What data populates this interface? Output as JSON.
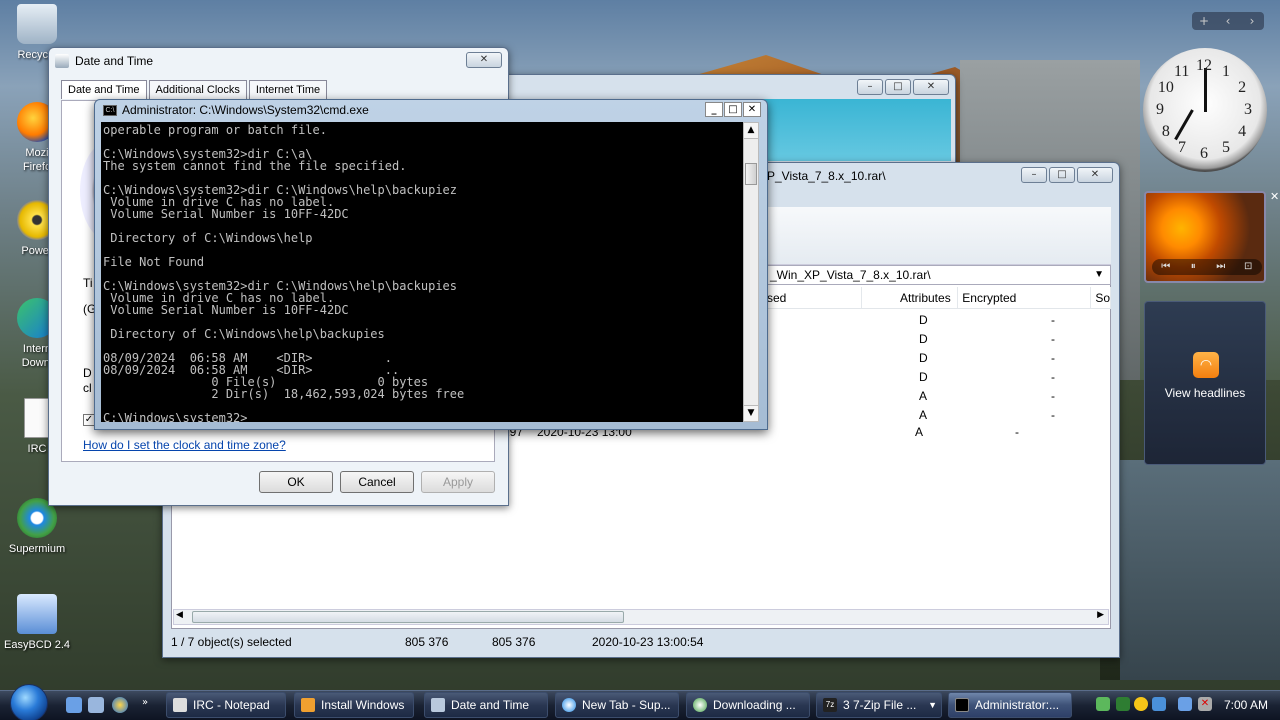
{
  "desktop": {
    "icons": [
      {
        "label": "Recycle"
      },
      {
        "label": "Mozi\nFirefo"
      },
      {
        "label": "Power"
      },
      {
        "label": "Intern\nDownl"
      },
      {
        "label": "IRC"
      },
      {
        "label": "Supermium"
      },
      {
        "label": "EasyBCD 2.4"
      }
    ]
  },
  "datetime_dialog": {
    "title": "Date and Time",
    "tabs": [
      "Date and Time",
      "Additional Clocks",
      "Internet Time"
    ],
    "side_letters": [
      "Ti",
      "(G",
      "D",
      "cl"
    ],
    "link": "How do I set the clock and time zone?",
    "buttons": {
      "ok": "OK",
      "cancel": "Cancel",
      "apply": "Apply"
    }
  },
  "zip_window": {
    "title_fragment": "P_Vista_7_8.x_10.rar\\",
    "path": "_Win_XP_Vista_7_8.x_10.rar\\",
    "columns": [
      "sed",
      "Attributes",
      "Encrypted",
      "So"
    ],
    "rows": [
      {
        "attr": "D",
        "enc": "-"
      },
      {
        "attr": "D",
        "enc": "-"
      },
      {
        "attr": "D",
        "enc": "-"
      },
      {
        "attr": "D",
        "enc": "-"
      },
      {
        "attr": "A",
        "enc": "-"
      },
      {
        "attr": "A",
        "enc": "-"
      },
      {
        "prefix": "197",
        "date": "2020-10-23 13:00",
        "attr": "A",
        "enc": "-"
      }
    ],
    "status": {
      "selected": "1 / 7 object(s) selected",
      "size": "805 376",
      "packed": "805 376",
      "modified": "2020-10-23 13:00:54"
    }
  },
  "cmd": {
    "title": "Administrator: C:\\Windows\\System32\\cmd.exe",
    "lines": [
      "operable program or batch file.",
      "",
      "C:\\Windows\\system32>dir C:\\a\\",
      "The system cannot find the file specified.",
      "",
      "C:\\Windows\\system32>dir C:\\Windows\\help\\backupiez",
      " Volume in drive C has no label.",
      " Volume Serial Number is 10FF-42DC",
      "",
      " Directory of C:\\Windows\\help",
      "",
      "File Not Found",
      "",
      "C:\\Windows\\system32>dir C:\\Windows\\help\\backupies",
      " Volume in drive C has no label.",
      " Volume Serial Number is 10FF-42DC",
      "",
      " Directory of C:\\Windows\\help\\backupies",
      "",
      "08/09/2024  06:58 AM    <DIR>          .",
      "08/09/2024  06:58 AM    <DIR>          ..",
      "               0 File(s)              0 bytes",
      "               2 Dir(s)  18,462,593,024 bytes free",
      "",
      "C:\\Windows\\system32>_"
    ]
  },
  "sidebar": {
    "clock_numbers": [
      "12",
      "1",
      "2",
      "3",
      "4",
      "5",
      "6",
      "7",
      "8",
      "9",
      "10",
      "11"
    ],
    "feeds_label": "View headlines"
  },
  "taskbar": {
    "buttons": [
      {
        "label": "IRC - Notepad"
      },
      {
        "label": "Install Windows"
      },
      {
        "label": "Date and Time"
      },
      {
        "label": "New Tab - Sup..."
      },
      {
        "label": "Downloading ..."
      },
      {
        "label": "3 7-Zip File ..."
      },
      {
        "label": "Administrator:..."
      }
    ],
    "time": "7:00 AM"
  }
}
